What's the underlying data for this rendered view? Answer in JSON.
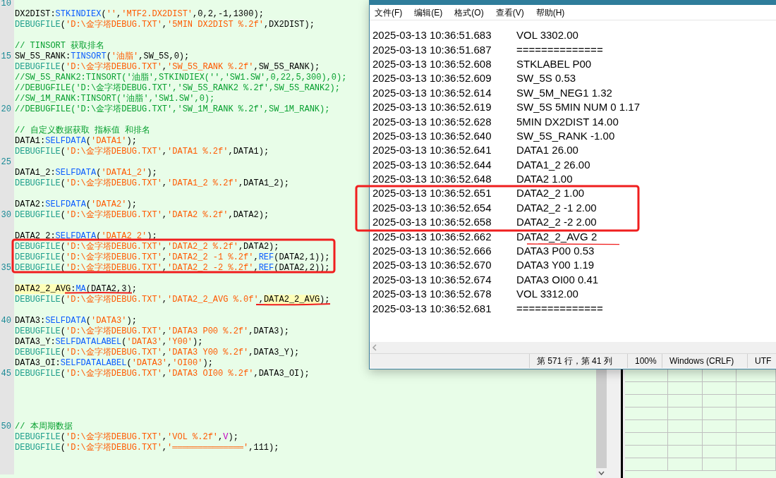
{
  "editor": {
    "lines": [
      {
        "kind": "blank",
        "line_number": "10"
      },
      {
        "tokens": [
          {
            "kind": "plain",
            "text": "DX2DIST:"
          },
          {
            "kind": "function",
            "text": "STKINDIEX"
          },
          {
            "kind": "plain",
            "text": "("
          },
          {
            "kind": "string",
            "text": "''"
          },
          {
            "kind": "plain",
            "text": ","
          },
          {
            "kind": "string",
            "text": "'MTF2.DX2DIST'"
          },
          {
            "kind": "plain",
            "text": ",0,2,-1,1300);"
          }
        ]
      },
      {
        "tokens": [
          {
            "kind": "debug",
            "text": "DEBUGFILE"
          },
          {
            "kind": "plain",
            "text": "("
          },
          {
            "kind": "string",
            "text": "'D:\\金字塔DEBUG.TXT'"
          },
          {
            "kind": "plain",
            "text": ","
          },
          {
            "kind": "string",
            "text": "'5MIN DX2DIST %.2f'"
          },
          {
            "kind": "plain",
            "text": ",DX2DIST);"
          }
        ]
      },
      {
        "kind": "blank"
      },
      {
        "tokens": [
          {
            "kind": "comment",
            "text": "// TINSORT 获取排名"
          }
        ]
      },
      {
        "line_number": "15",
        "tokens": [
          {
            "kind": "plain",
            "text": "SW_5S_RANK:"
          },
          {
            "kind": "function",
            "text": "TINSORT"
          },
          {
            "kind": "plain",
            "text": "("
          },
          {
            "kind": "string",
            "text": "'油脂'"
          },
          {
            "kind": "plain",
            "text": ",SW_5S,0);"
          }
        ]
      },
      {
        "tokens": [
          {
            "kind": "debug",
            "text": "DEBUGFILE"
          },
          {
            "kind": "plain",
            "text": "("
          },
          {
            "kind": "string",
            "text": "'D:\\金字塔DEBUG.TXT'"
          },
          {
            "kind": "plain",
            "text": ","
          },
          {
            "kind": "string",
            "text": "'SW_5S_RANK %.2f'"
          },
          {
            "kind": "plain",
            "text": ",SW_5S_RANK);"
          }
        ]
      },
      {
        "tokens": [
          {
            "kind": "comment",
            "text": "//SW_5S_RANK2:TINSORT('油脂',STKINDIEX('','SW1.SW',0,22,5,300),0);"
          }
        ]
      },
      {
        "tokens": [
          {
            "kind": "comment",
            "text": "//DEBUGFILE('D:\\金字塔DEBUG.TXT','SW_5S_RANK2 %.2f',SW_5S_RANK2);"
          }
        ]
      },
      {
        "tokens": [
          {
            "kind": "comment",
            "text": "//SW_1M_RANK:TINSORT('油脂','SW1.SW',0);"
          }
        ]
      },
      {
        "line_number": "20",
        "tokens": [
          {
            "kind": "comment",
            "text": "//DEBUGFILE('D:\\金字塔DEBUG.TXT','SW_1M_RANK %.2f',SW_1M_RANK);"
          }
        ]
      },
      {
        "kind": "blank"
      },
      {
        "tokens": [
          {
            "kind": "comment",
            "text": "// 自定义数据获取 指标值 和排名"
          }
        ]
      },
      {
        "tokens": [
          {
            "kind": "plain",
            "text": "DATA1:"
          },
          {
            "kind": "function",
            "text": "SELFDATA"
          },
          {
            "kind": "plain",
            "text": "("
          },
          {
            "kind": "string",
            "text": "'DATA1'"
          },
          {
            "kind": "plain",
            "text": ");"
          }
        ]
      },
      {
        "tokens": [
          {
            "kind": "debug",
            "text": "DEBUGFILE"
          },
          {
            "kind": "plain",
            "text": "("
          },
          {
            "kind": "string",
            "text": "'D:\\金字塔DEBUG.TXT'"
          },
          {
            "kind": "plain",
            "text": ","
          },
          {
            "kind": "string",
            "text": "'DATA1 %.2f'"
          },
          {
            "kind": "plain",
            "text": ",DATA1);"
          }
        ]
      },
      {
        "kind": "blank",
        "line_number": "25"
      },
      {
        "tokens": [
          {
            "kind": "plain",
            "text": "DATA1_2:"
          },
          {
            "kind": "function",
            "text": "SELFDATA"
          },
          {
            "kind": "plain",
            "text": "("
          },
          {
            "kind": "string",
            "text": "'DATA1_2'"
          },
          {
            "kind": "plain",
            "text": ");"
          }
        ]
      },
      {
        "tokens": [
          {
            "kind": "debug",
            "text": "DEBUGFILE"
          },
          {
            "kind": "plain",
            "text": "("
          },
          {
            "kind": "string",
            "text": "'D:\\金字塔DEBUG.TXT'"
          },
          {
            "kind": "plain",
            "text": ","
          },
          {
            "kind": "string",
            "text": "'DATA1_2 %.2f'"
          },
          {
            "kind": "plain",
            "text": ",DATA1_2);"
          }
        ]
      },
      {
        "kind": "blank"
      },
      {
        "tokens": [
          {
            "kind": "plain",
            "text": "DATA2:"
          },
          {
            "kind": "function",
            "text": "SELFDATA"
          },
          {
            "kind": "plain",
            "text": "("
          },
          {
            "kind": "string",
            "text": "'DATA2'"
          },
          {
            "kind": "plain",
            "text": ");"
          }
        ]
      },
      {
        "line_number": "30",
        "tokens": [
          {
            "kind": "debug",
            "text": "DEBUGFILE"
          },
          {
            "kind": "plain",
            "text": "("
          },
          {
            "kind": "string",
            "text": "'D:\\金字塔DEBUG.TXT'"
          },
          {
            "kind": "plain",
            "text": ","
          },
          {
            "kind": "string",
            "text": "'DATA2 %.2f'"
          },
          {
            "kind": "plain",
            "text": ",DATA2);"
          }
        ]
      },
      {
        "kind": "blank"
      },
      {
        "tokens": [
          {
            "kind": "plain",
            "text": "DATA2_2:"
          },
          {
            "kind": "function",
            "text": "SELFDATA"
          },
          {
            "kind": "plain",
            "text": "("
          },
          {
            "kind": "string",
            "text": "'DATA2_2'"
          },
          {
            "kind": "plain",
            "text": ");"
          }
        ]
      },
      {
        "tokens": [
          {
            "kind": "debug",
            "text": "DEBUGFILE"
          },
          {
            "kind": "plain",
            "text": "("
          },
          {
            "kind": "string",
            "text": "'D:\\金字塔DEBUG.TXT'"
          },
          {
            "kind": "plain",
            "text": ","
          },
          {
            "kind": "string",
            "text": "'DATA2_2 %.2f'"
          },
          {
            "kind": "plain",
            "text": ",DATA2);"
          }
        ]
      },
      {
        "tokens": [
          {
            "kind": "debug",
            "text": "DEBUGFILE"
          },
          {
            "kind": "plain",
            "text": "("
          },
          {
            "kind": "string",
            "text": "'D:\\金字塔DEBUG.TXT'"
          },
          {
            "kind": "plain",
            "text": ","
          },
          {
            "kind": "string",
            "text": "'DATA2_2 -1 %.2f'"
          },
          {
            "kind": "plain",
            "text": ","
          },
          {
            "kind": "function",
            "text": "REF"
          },
          {
            "kind": "plain",
            "text": "(DATA2,1));"
          }
        ]
      },
      {
        "line_number": "35",
        "tokens": [
          {
            "kind": "debug",
            "text": "DEBUGFILE"
          },
          {
            "kind": "plain",
            "text": "("
          },
          {
            "kind": "string",
            "text": "'D:\\金字塔DEBUG.TXT'"
          },
          {
            "kind": "plain",
            "text": ","
          },
          {
            "kind": "string",
            "text": "'DATA2_2 -2 %.2f'"
          },
          {
            "kind": "plain",
            "text": ","
          },
          {
            "kind": "function",
            "text": "REF"
          },
          {
            "kind": "plain",
            "text": "(DATA2,2));"
          }
        ]
      },
      {
        "kind": "blank"
      },
      {
        "tokens": [
          {
            "kind": "match",
            "text": "DATA2_2_AVG"
          },
          {
            "kind": "plain",
            "text": ":"
          },
          {
            "kind": "function",
            "text": "MA"
          },
          {
            "kind": "plain",
            "text": "(DATA2,3);"
          }
        ]
      },
      {
        "tokens": [
          {
            "kind": "debug",
            "text": "DEBUGFILE"
          },
          {
            "kind": "plain",
            "text": "("
          },
          {
            "kind": "string",
            "text": "'D:\\金字塔DEBUG.TXT'"
          },
          {
            "kind": "plain",
            "text": ","
          },
          {
            "kind": "string",
            "text": "'DATA2_2_AVG %.0f'"
          },
          {
            "kind": "plain",
            "text": ","
          },
          {
            "kind": "match",
            "text": "DATA2_2_AVG"
          },
          {
            "kind": "plain",
            "text": ");"
          }
        ]
      },
      {
        "kind": "blank"
      },
      {
        "line_number": "40",
        "tokens": [
          {
            "kind": "plain",
            "text": "DATA3:"
          },
          {
            "kind": "function",
            "text": "SELFDATA"
          },
          {
            "kind": "plain",
            "text": "("
          },
          {
            "kind": "string",
            "text": "'DATA3'"
          },
          {
            "kind": "plain",
            "text": ");"
          }
        ]
      },
      {
        "tokens": [
          {
            "kind": "debug",
            "text": "DEBUGFILE"
          },
          {
            "kind": "plain",
            "text": "("
          },
          {
            "kind": "string",
            "text": "'D:\\金字塔DEBUG.TXT'"
          },
          {
            "kind": "plain",
            "text": ","
          },
          {
            "kind": "string",
            "text": "'DATA3 P00 %.2f'"
          },
          {
            "kind": "plain",
            "text": ",DATA3);"
          }
        ]
      },
      {
        "tokens": [
          {
            "kind": "plain",
            "text": "DATA3_Y:"
          },
          {
            "kind": "function",
            "text": "SELFDATALABEL"
          },
          {
            "kind": "plain",
            "text": "("
          },
          {
            "kind": "string",
            "text": "'DATA3'"
          },
          {
            "kind": "plain",
            "text": ","
          },
          {
            "kind": "string",
            "text": "'Y00'"
          },
          {
            "kind": "plain",
            "text": ");"
          }
        ]
      },
      {
        "tokens": [
          {
            "kind": "debug",
            "text": "DEBUGFILE"
          },
          {
            "kind": "plain",
            "text": "("
          },
          {
            "kind": "string",
            "text": "'D:\\金字塔DEBUG.TXT'"
          },
          {
            "kind": "plain",
            "text": ","
          },
          {
            "kind": "string",
            "text": "'DATA3 Y00 %.2f'"
          },
          {
            "kind": "plain",
            "text": ",DATA3_Y);"
          }
        ]
      },
      {
        "tokens": [
          {
            "kind": "plain",
            "text": "DATA3_OI:"
          },
          {
            "kind": "function",
            "text": "SELFDATALABEL"
          },
          {
            "kind": "plain",
            "text": "("
          },
          {
            "kind": "string",
            "text": "'DATA3'"
          },
          {
            "kind": "plain",
            "text": ","
          },
          {
            "kind": "string",
            "text": "'OI00'"
          },
          {
            "kind": "plain",
            "text": ");"
          }
        ]
      },
      {
        "line_number": "45",
        "tokens": [
          {
            "kind": "debug",
            "text": "DEBUGFILE"
          },
          {
            "kind": "plain",
            "text": "("
          },
          {
            "kind": "string",
            "text": "'D:\\金字塔DEBUG.TXT'"
          },
          {
            "kind": "plain",
            "text": ","
          },
          {
            "kind": "string",
            "text": "'DATA3 OI00 %.2f'"
          },
          {
            "kind": "plain",
            "text": ",DATA3_OI);"
          }
        ]
      },
      {
        "kind": "blank"
      },
      {
        "kind": "blank"
      },
      {
        "kind": "blank"
      },
      {
        "kind": "blank"
      },
      {
        "line_number": "50",
        "tokens": [
          {
            "kind": "comment",
            "text": "// 本周期数据"
          }
        ]
      },
      {
        "tokens": [
          {
            "kind": "debug",
            "text": "DEBUGFILE"
          },
          {
            "kind": "plain",
            "text": "("
          },
          {
            "kind": "string",
            "text": "'D:\\金字塔DEBUG.TXT'"
          },
          {
            "kind": "plain",
            "text": ","
          },
          {
            "kind": "string",
            "text": "'VOL %.2f'"
          },
          {
            "kind": "plain",
            "text": ","
          },
          {
            "kind": "variable",
            "text": "V"
          },
          {
            "kind": "plain",
            "text": ");"
          }
        ]
      },
      {
        "tokens": [
          {
            "kind": "debug",
            "text": "DEBUGFILE"
          },
          {
            "kind": "plain",
            "text": "("
          },
          {
            "kind": "string",
            "text": "'D:\\金字塔DEBUG.TXT'"
          },
          {
            "kind": "plain",
            "text": ","
          },
          {
            "kind": "string",
            "text": "'══════════════'"
          },
          {
            "kind": "plain",
            "text": ",111);"
          }
        ]
      }
    ]
  },
  "notepad": {
    "menu": [
      "文件(F)",
      "编辑(E)",
      "格式(O)",
      "查看(V)",
      "帮助(H)"
    ],
    "log": [
      {
        "time": "2025-03-13 10:36:51.683",
        "message": "VOL 3302.00"
      },
      {
        "time": "2025-03-13 10:36:51.687",
        "message": "=============="
      },
      {
        "time": "2025-03-13 10:36:52.608",
        "message": "STKLABEL P00"
      },
      {
        "time": "2025-03-13 10:36:52.609",
        "message": "SW_5S 0.53"
      },
      {
        "time": "2025-03-13 10:36:52.614",
        "message": "SW_5M_NEG1 1.32"
      },
      {
        "time": "2025-03-13 10:36:52.619",
        "message": "SW_5S 5MIN NUM 0 1.17"
      },
      {
        "time": "2025-03-13 10:36:52.628",
        "message": "5MIN DX2DIST 14.00"
      },
      {
        "time": "2025-03-13 10:36:52.640",
        "message": "SW_5S_RANK -1.00"
      },
      {
        "time": "2025-03-13 10:36:52.641",
        "message": "DATA1 26.00"
      },
      {
        "time": "2025-03-13 10:36:52.644",
        "message": "DATA1_2 26.00"
      },
      {
        "time": "2025-03-13 10:36:52.648",
        "message": "DATA2 1.00"
      },
      {
        "time": "2025-03-13 10:36:52.651",
        "message": "DATA2_2 1.00"
      },
      {
        "time": "2025-03-13 10:36:52.654",
        "message": "DATA2_2 -1 2.00"
      },
      {
        "time": "2025-03-13 10:36:52.658",
        "message": "DATA2_2 -2 2.00"
      },
      {
        "time": "2025-03-13 10:36:52.662",
        "message": "DATA2_2_AVG 2"
      },
      {
        "time": "2025-03-13 10:36:52.666",
        "message": "DATA3 P00 0.53"
      },
      {
        "time": "2025-03-13 10:36:52.670",
        "message": "DATA3 Y00 1.19"
      },
      {
        "time": "2025-03-13 10:36:52.674",
        "message": "DATA3 OI00 0.41"
      },
      {
        "time": "2025-03-13 10:36:52.678",
        "message": "VOL 3312.00"
      },
      {
        "time": "2025-03-13 10:36:52.681",
        "message": "=============="
      }
    ],
    "status_bar": [
      "第 571 行，第 41 列",
      "100%",
      "Windows (CRLF)",
      "UTF"
    ]
  }
}
